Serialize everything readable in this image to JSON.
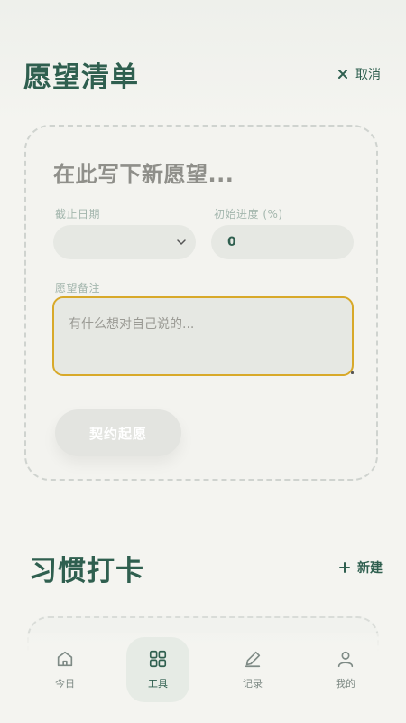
{
  "wishlist": {
    "title": "愿望清单",
    "cancel_label": "取消",
    "form": {
      "wish_placeholder": "在此写下新愿望...",
      "deadline_label": "截止日期",
      "deadline_value": "",
      "progress_label": "初始进度 (%)",
      "progress_value": "0",
      "note_label": "愿望备注",
      "note_placeholder": "有什么想对自己说的...",
      "submit_label": "契约起愿"
    }
  },
  "habits": {
    "title": "习惯打卡",
    "new_label": "新建"
  },
  "nav": {
    "items": [
      {
        "label": "今日",
        "icon": "home-icon"
      },
      {
        "label": "工具",
        "icon": "grid-icon",
        "active": true
      },
      {
        "label": "记录",
        "icon": "pen-icon"
      },
      {
        "label": "我的",
        "icon": "user-icon"
      }
    ]
  },
  "colors": {
    "primary": "#2f5f4f",
    "background": "#f4f4f0",
    "field": "#e6e8e3",
    "focus_border": "#d8a92a",
    "nav_active": "#e6ebe5"
  }
}
